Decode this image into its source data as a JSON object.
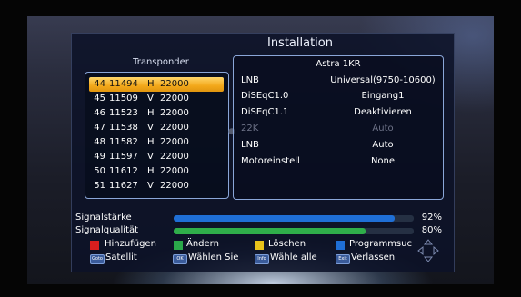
{
  "title": "Installation",
  "transponder": {
    "label": "Transponder",
    "rows": [
      {
        "num": "44",
        "freq": "11494",
        "pol": "H",
        "sr": "22000",
        "selected": true
      },
      {
        "num": "45",
        "freq": "11509",
        "pol": "V",
        "sr": "22000"
      },
      {
        "num": "46",
        "freq": "11523",
        "pol": "H",
        "sr": "22000"
      },
      {
        "num": "47",
        "freq": "11538",
        "pol": "V",
        "sr": "22000"
      },
      {
        "num": "48",
        "freq": "11582",
        "pol": "H",
        "sr": "22000"
      },
      {
        "num": "49",
        "freq": "11597",
        "pol": "V",
        "sr": "22000"
      },
      {
        "num": "50",
        "freq": "11612",
        "pol": "H",
        "sr": "22000"
      },
      {
        "num": "51",
        "freq": "11627",
        "pol": "V",
        "sr": "22000"
      }
    ]
  },
  "info": {
    "satellite": "Astra 1KR",
    "rows": [
      {
        "label": "LNB",
        "value": "Universal(9750-10600)",
        "enabled": true
      },
      {
        "label": "DiSEqC1.0",
        "value": "Eingang1",
        "enabled": true
      },
      {
        "label": "DiSEqC1.1",
        "value": "Deaktivieren",
        "enabled": true
      },
      {
        "label": "22K",
        "value": "Auto",
        "enabled": false
      },
      {
        "label": "LNB",
        "value": "Auto",
        "enabled": true
      },
      {
        "label": "Motoreinstell",
        "value": "None",
        "enabled": true
      }
    ]
  },
  "signal": {
    "strength_label": "Signalstärke",
    "strength_value": 92,
    "strength_text": "92%",
    "quality_label": "Signalqualität",
    "quality_value": 80,
    "quality_text": "80%",
    "strength_color": "#1f6fd6",
    "quality_color": "#2fae4a"
  },
  "color_keys": [
    {
      "color": "#d81e1e",
      "label": "Hinzufügen"
    },
    {
      "color": "#2aa84a",
      "label": "Ändern"
    },
    {
      "color": "#e8c21a",
      "label": "Löschen"
    },
    {
      "color": "#1f6fd6",
      "label": "Programmsuc"
    }
  ],
  "remote_keys": [
    {
      "key": "Goto",
      "label": "Satellit"
    },
    {
      "key": "OK",
      "label": "Wählen Sie"
    },
    {
      "key": "Info",
      "label": "Wähle alle"
    },
    {
      "key": "Exit",
      "label": "Verlassen"
    }
  ],
  "nav_icon": "direction-pad-icon"
}
